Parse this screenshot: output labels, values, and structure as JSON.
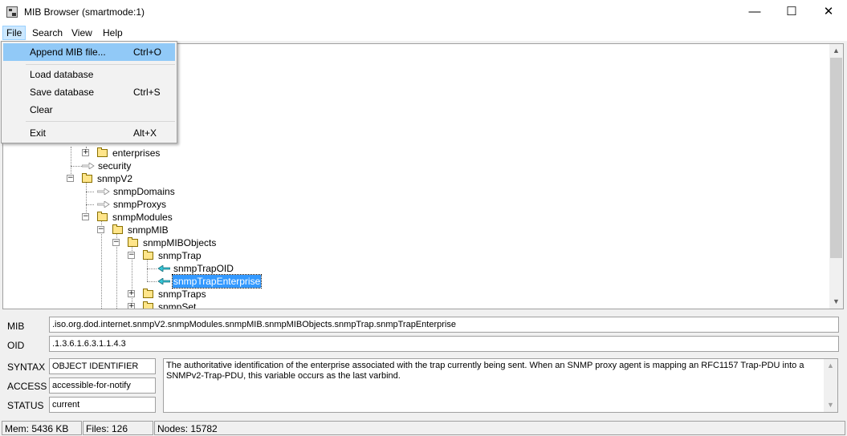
{
  "window": {
    "title": "MIB Browser (smartmode:1)",
    "minimize": "—",
    "maximize": "☐",
    "close": "✕"
  },
  "menubar": {
    "file": "File",
    "search": "Search",
    "view": "View",
    "help": "Help"
  },
  "file_menu": {
    "items": [
      {
        "label": "Append MIB file...",
        "shortcut": "Ctrl+O"
      },
      {
        "label": "Load database",
        "shortcut": ""
      },
      {
        "label": "Save database",
        "shortcut": "Ctrl+S"
      },
      {
        "label": "Clear",
        "shortcut": ""
      },
      {
        "label": "Exit",
        "shortcut": "Alt+X"
      }
    ]
  },
  "tree": {
    "nodes": [
      {
        "label": "enterprises",
        "expander": "+"
      },
      {
        "label": "security"
      },
      {
        "label": "snmpV2",
        "expander": "−"
      },
      {
        "label": "snmpDomains"
      },
      {
        "label": "snmpProxys"
      },
      {
        "label": "snmpModules",
        "expander": "−"
      },
      {
        "label": "snmpMIB",
        "expander": "−"
      },
      {
        "label": "snmpMIBObjects",
        "expander": "−"
      },
      {
        "label": "snmpTrap",
        "expander": "−"
      },
      {
        "label": "snmpTrapOID"
      },
      {
        "label": "snmpTrapEnterprise"
      },
      {
        "label": "snmpTraps",
        "expander": "+"
      },
      {
        "label": "snmpSet",
        "expander": "+"
      }
    ]
  },
  "details": {
    "mib_label": "MIB",
    "mib_value": ".iso.org.dod.internet.snmpV2.snmpModules.snmpMIB.snmpMIBObjects.snmpTrap.snmpTrapEnterprise",
    "oid_label": "OID",
    "oid_value": ".1.3.6.1.6.3.1.1.4.3",
    "syntax_label": "SYNTAX",
    "syntax_value": "OBJECT IDENTIFIER",
    "access_label": "ACCESS",
    "access_value": "accessible-for-notify",
    "status_label": "STATUS",
    "status_value": "current",
    "description": "The authoritative identification of the enterprise associated with the trap currently being sent.  When an SNMP proxy agent is mapping an RFC1157 Trap-PDU into a SNMPv2-Trap-PDU, this variable occurs as the last varbind."
  },
  "statusbar": {
    "mem": "Mem: 5436 KB",
    "files": "Files: 126",
    "nodes": "Nodes: 15782"
  }
}
